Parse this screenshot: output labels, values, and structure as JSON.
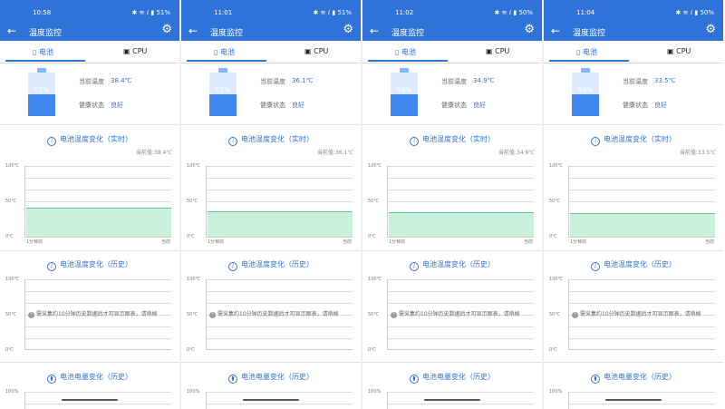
{
  "app": {
    "title": "温度监控",
    "icons": {
      "back": "back-arrow-icon",
      "settings": "gear-icon"
    },
    "colors": {
      "accent": "#2f73d8",
      "battery_fill": "#3f86ef",
      "chart_band": "#c9f0da"
    }
  },
  "tabs": [
    "电池",
    "CPU"
  ],
  "labels": {
    "current_temp": "当前温度",
    "health": "健康状态",
    "realtime_chart_title": "电池温度变化（实时）",
    "history_chart_title": "电池温度变化（历史）",
    "power_chart_title": "电池电量变化（历史）",
    "realtime_axis": [
      "100℃",
      "50℃",
      "0℃"
    ],
    "history_axis": [
      "100℃",
      "50℃",
      "0℃"
    ],
    "power_axis_top": "100%",
    "x_start": "1分钟前",
    "x_end": "当前",
    "notice": "需采集约10分钟历史数据后才可显示图表，请稍候"
  },
  "screens": [
    {
      "time": "10:58",
      "battery_percent": "51%",
      "battery_level": 51,
      "temp": "38.4℃",
      "health": "良好",
      "current_value": "当前值:38.4℃",
      "status_icons": "✱ ≋ ⅈ ▮ 51%"
    },
    {
      "time": "11:01",
      "battery_percent": "51%",
      "battery_level": 51,
      "temp": "36.1℃",
      "health": "良好",
      "current_value": "当前值:36.1℃",
      "status_icons": "✱ ≋ ⅈ ▮ 51%"
    },
    {
      "time": "11:02",
      "battery_percent": "50%",
      "battery_level": 50,
      "temp": "34.9℃",
      "health": "良好",
      "current_value": "当前值:34.9℃",
      "status_icons": "✱ ≋ ⅈ ▮ 50%"
    },
    {
      "time": "11:04",
      "battery_percent": "50%",
      "battery_level": 50,
      "temp": "33.5℃",
      "health": "良好",
      "current_value": "当前值:33.5℃",
      "status_icons": "✱ ≋ ⅈ ▮ 50%"
    }
  ]
}
